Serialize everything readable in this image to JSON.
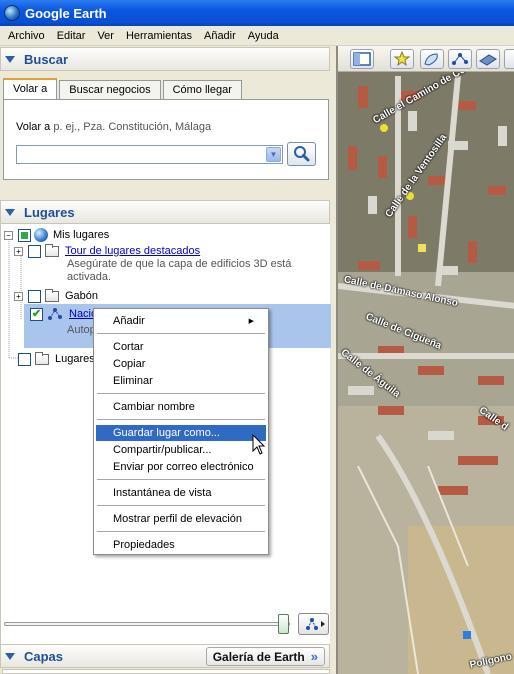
{
  "window": {
    "title": "Google Earth"
  },
  "menu": [
    "Archivo",
    "Editar",
    "Ver",
    "Herramientas",
    "Añadir",
    "Ayuda"
  ],
  "search_panel": {
    "title": "Buscar",
    "tabs": [
      "Volar a",
      "Buscar negocios",
      "Cómo llegar"
    ],
    "fly_to_label": "Volar a",
    "fly_to_hint": "p. ej., Pza. Constitución, Málaga",
    "input_value": ""
  },
  "places_panel": {
    "title": "Lugares",
    "my_places": "Mis lugares",
    "tour_link": "Tour de lugares destacados",
    "tour_desc_1": "Asegúrate de que la capa de edificios 3D está",
    "tour_desc_2": "activada.",
    "gabon": "Gabón",
    "selected_link": "Nacio",
    "selected_desc": "Autop",
    "temp_places": "Lugares"
  },
  "layers_panel": {
    "title": "Capas",
    "gallery_button": "Galería de Earth",
    "gallery_arrow": "»"
  },
  "context_menu": {
    "items": [
      "Añadir",
      "Cortar",
      "Copiar",
      "Eliminar",
      "Cambiar nombre",
      "Guardar lugar como...",
      "Compartir/publicar...",
      "Enviar por correo electrónico",
      "Instantánea de vista",
      "Mostrar perfil de elevación",
      "Propiedades"
    ],
    "highlighted": "Guardar lugar como..."
  },
  "map": {
    "street_labels": [
      "Calle el Camino de Colm",
      "Calle de la Ventosilla",
      "Calle de Dámaso Alonso",
      "Calle de Cigüeña",
      "Calle de Águila",
      "Calle d",
      "Polígono"
    ]
  },
  "colors": {
    "title_bar": "#0a4fd4",
    "panel_header_text": "#1f4f9a",
    "selection": "#a9c5eb",
    "menu_highlight": "#316ac5"
  }
}
